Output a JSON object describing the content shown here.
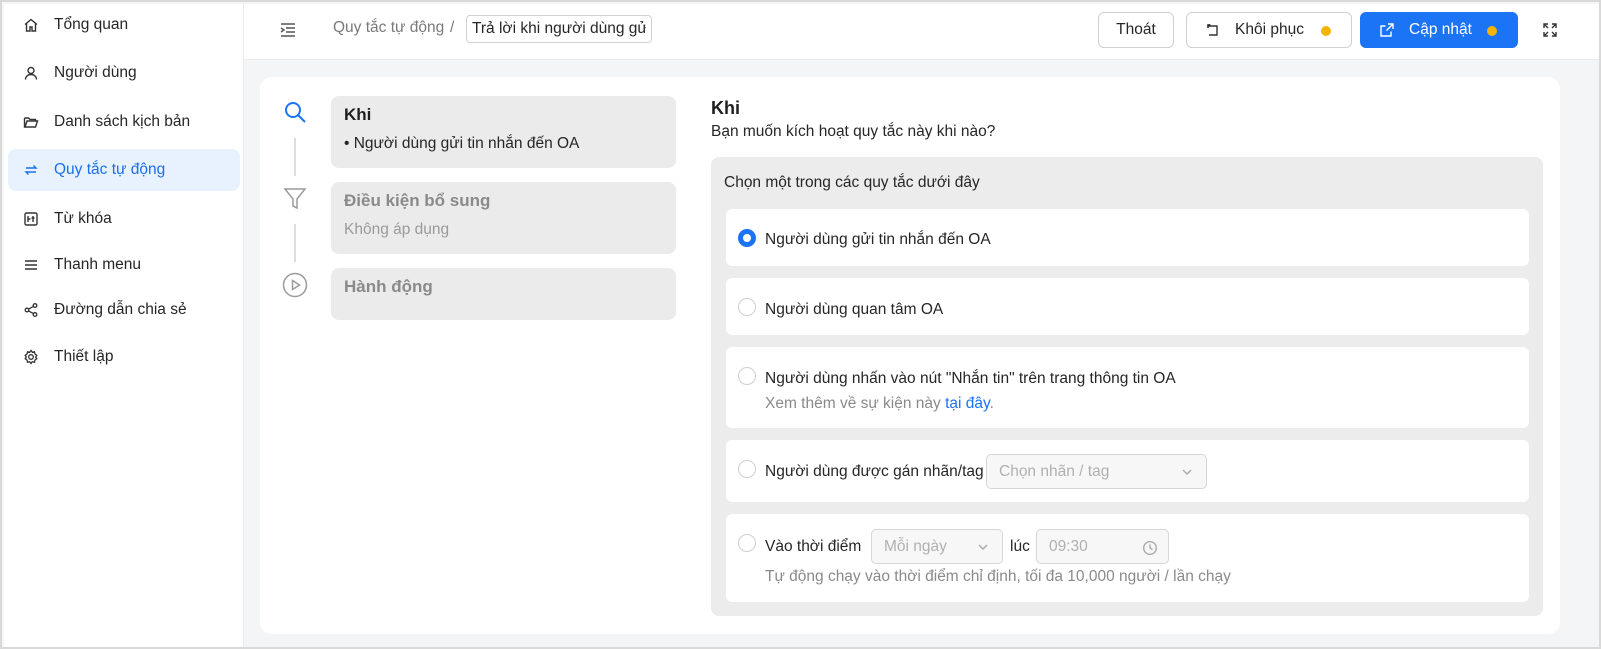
{
  "sidebar": {
    "items": [
      {
        "label": "Tổng quan",
        "icon": "home-icon",
        "active": false
      },
      {
        "label": "Người dùng",
        "icon": "user-icon",
        "active": false
      },
      {
        "label": "Danh sách kịch bản",
        "icon": "folder-icon",
        "active": false
      },
      {
        "label": "Quy tắc tự động",
        "icon": "repeat-icon",
        "active": true
      },
      {
        "label": "Từ khóa",
        "icon": "keyword-icon",
        "active": false
      },
      {
        "label": "Thanh menu",
        "icon": "menu-icon",
        "active": false
      },
      {
        "label": "Đường dẫn chia sẻ",
        "icon": "share-icon",
        "active": false
      },
      {
        "label": "Thiết lập",
        "icon": "settings-icon",
        "active": false
      }
    ]
  },
  "header": {
    "breadcrumb_parent": "Quy tắc tự động",
    "breadcrumb_sep": "/",
    "rule_name": "Trả lời khi người dùng gửi tin nhắn",
    "exit_label": "Thoát",
    "restore_label": "Khôi phục",
    "update_label": "Cập nhật",
    "accent": "#1b74f5",
    "dot_color": "#f5b400"
  },
  "steps": [
    {
      "title": "Khi",
      "subtitle": "• Người dùng gửi tin nhắn đến OA",
      "icon": "search-icon",
      "active": true
    },
    {
      "title": "Điều kiện bổ sung",
      "subtitle": "Không áp dụng",
      "icon": "filter-icon",
      "active": false
    },
    {
      "title": "Hành động",
      "subtitle": "",
      "icon": "play-icon",
      "active": false
    }
  ],
  "panel": {
    "title": "Khi",
    "subtitle": "Bạn muốn kích hoạt quy tắc này khi nào?",
    "choose_label": "Chọn một trong các quy tắc dưới đây",
    "options": [
      {
        "label": "Người dùng gửi tin nhắn đến OA",
        "checked": true
      },
      {
        "label": "Người dùng quan tâm OA",
        "checked": false
      },
      {
        "label": "Người dùng nhấn vào nút \"Nhắn tin\" trên trang thông tin OA",
        "hint": "Xem thêm về sự kiện này ",
        "hint_link": "tại đây",
        "hint_end": ".",
        "checked": false
      },
      {
        "label": "Người dùng được gán nhãn/tag",
        "select_placeholder": "Chọn nhãn / tag",
        "checked": false
      },
      {
        "label": "Vào thời điểm",
        "frequency_placeholder": "Mỗi ngày",
        "at_label": "lúc",
        "time_placeholder": "09:30",
        "hint": "Tự động chạy vào thời điểm chỉ định, tối đa 10,000 người / lần chạy",
        "checked": false
      }
    ]
  }
}
